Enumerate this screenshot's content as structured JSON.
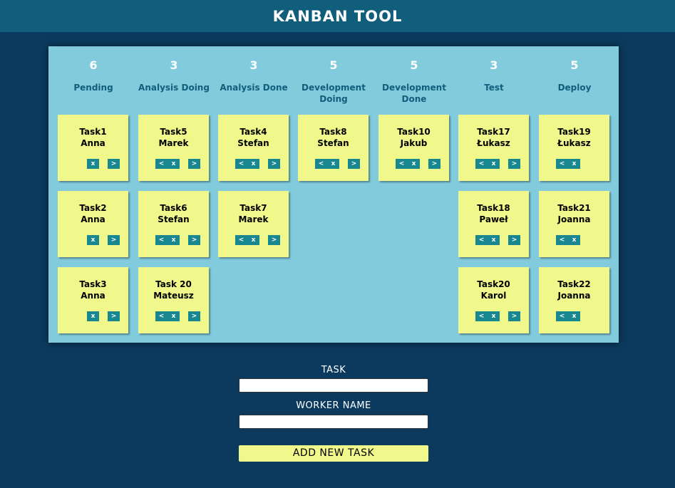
{
  "header": {
    "title": "KANBAN TOOL"
  },
  "columns": [
    {
      "count": "6",
      "name": "Pending",
      "cards": [
        {
          "task": "Task1",
          "worker": "Anna",
          "prev": "",
          "del": "x",
          "next": ">"
        },
        {
          "task": "Task2",
          "worker": "Anna",
          "prev": "",
          "del": "x",
          "next": ">"
        },
        {
          "task": "Task3",
          "worker": "Anna",
          "prev": "",
          "del": "x",
          "next": ">"
        }
      ]
    },
    {
      "count": "3",
      "name": "Analysis Doing",
      "cards": [
        {
          "task": "Task5",
          "worker": "Marek",
          "prev": "<",
          "del": "x",
          "next": ">"
        },
        {
          "task": "Task6",
          "worker": "Stefan",
          "prev": "<",
          "del": "x",
          "next": ">"
        },
        {
          "task": "Task 20",
          "worker": "Mateusz",
          "prev": "<",
          "del": "x",
          "next": ">"
        }
      ]
    },
    {
      "count": "3",
      "name": "Analysis Done",
      "cards": [
        {
          "task": "Task4",
          "worker": "Stefan",
          "prev": "<",
          "del": "x",
          "next": ">"
        },
        {
          "task": "Task7",
          "worker": "Marek",
          "prev": "<",
          "del": "x",
          "next": ">"
        }
      ]
    },
    {
      "count": "5",
      "name": "Development Doing",
      "cards": [
        {
          "task": "Task8",
          "worker": "Stefan",
          "prev": "<",
          "del": "x",
          "next": ">"
        }
      ]
    },
    {
      "count": "5",
      "name": "Development Done",
      "cards": [
        {
          "task": "Task10",
          "worker": "Jakub",
          "prev": "<",
          "del": "x",
          "next": ">"
        }
      ]
    },
    {
      "count": "3",
      "name": "Test",
      "cards": [
        {
          "task": "Task17",
          "worker": "Łukasz",
          "prev": "<",
          "del": "x",
          "next": ">"
        },
        {
          "task": "Task18",
          "worker": "Paweł",
          "prev": "<",
          "del": "x",
          "next": ">"
        },
        {
          "task": "Task20",
          "worker": "Karol",
          "prev": "<",
          "del": "x",
          "next": ">"
        }
      ]
    },
    {
      "count": "5",
      "name": "Deploy",
      "cards": [
        {
          "task": "Task19",
          "worker": "Łukasz",
          "prev": "<",
          "del": "x",
          "next": ""
        },
        {
          "task": "Task21",
          "worker": "Joanna",
          "prev": "<",
          "del": "x",
          "next": ""
        },
        {
          "task": "Task22",
          "worker": "Joanna",
          "prev": "<",
          "del": "x",
          "next": ""
        }
      ]
    }
  ],
  "form": {
    "task_label": "TASK",
    "task_value": "",
    "worker_label": "WORKER NAME",
    "worker_value": "",
    "submit_label": "ADD NEW TASK"
  },
  "colors": {
    "background": "#0b3a5e",
    "header": "#115d7c",
    "board": "#82cbdd",
    "card": "#f1f88b",
    "button": "#18878f"
  }
}
